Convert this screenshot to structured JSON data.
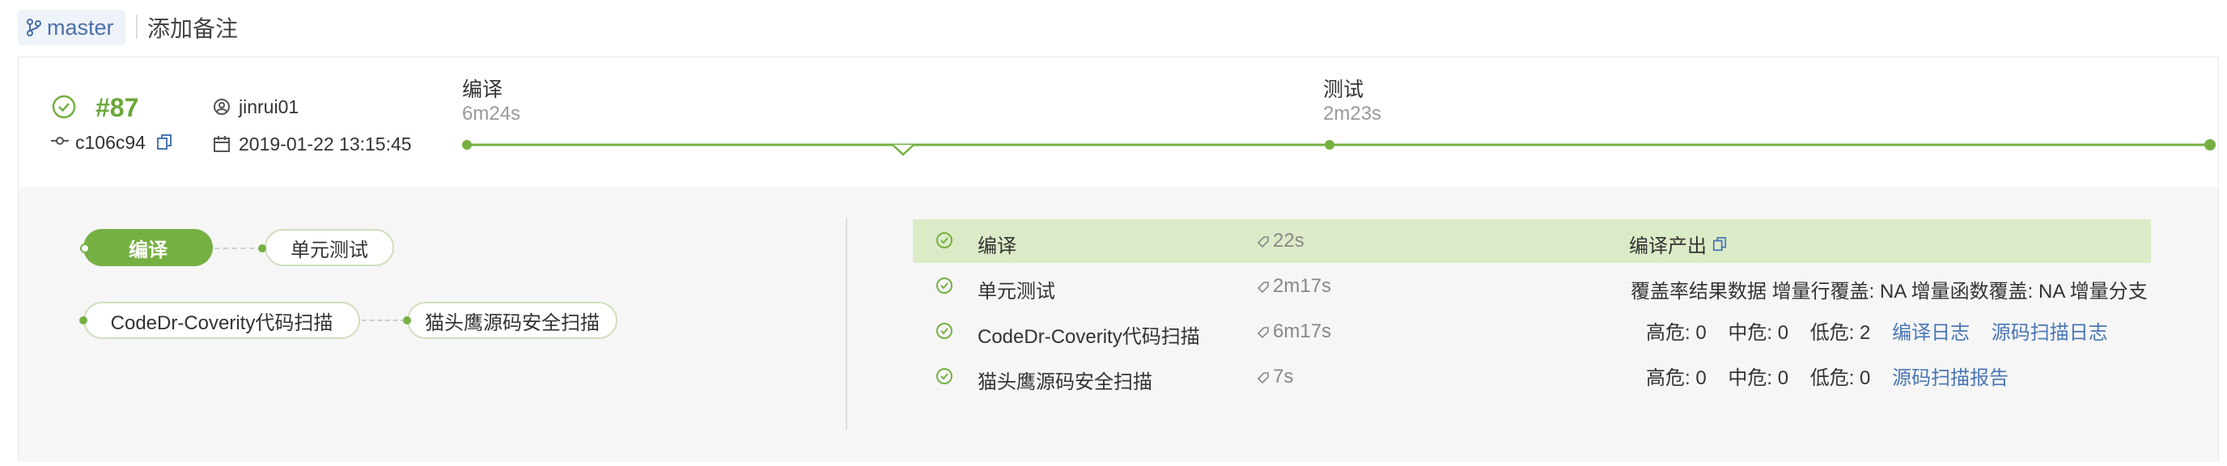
{
  "header": {
    "branch": "master",
    "add_note": "添加备注"
  },
  "build": {
    "number": "#87",
    "commit": "c106c94",
    "user": "jinrui01",
    "datetime": "2019-01-22 13:15:45"
  },
  "timeline": {
    "stages": [
      {
        "name": "编译",
        "duration": "6m24s"
      },
      {
        "name": "测试",
        "duration": "2m23s"
      }
    ]
  },
  "pipeline": {
    "nodes": [
      "编译",
      "单元测试",
      "CodeDr-Coverity代码扫描",
      "猫头鹰源码安全扫描"
    ]
  },
  "jobs": [
    {
      "name": "编译",
      "duration": "22s",
      "artifact_label": "编译产出"
    },
    {
      "name": "单元测试",
      "duration": "2m17s",
      "coverage": "覆盖率结果数据 增量行覆盖: NA 增量函数覆盖: NA 增量分支"
    },
    {
      "name": "CodeDr-Coverity代码扫描",
      "duration": "6m17s",
      "high": "高危: 0",
      "mid": "中危: 0",
      "low": "低危: 2",
      "link1": "编译日志",
      "link2": "源码扫描日志"
    },
    {
      "name": "猫头鹰源码安全扫描",
      "duration": "7s",
      "high": "高危: 0",
      "mid": "中危: 0",
      "low": "低危: 0",
      "link1": "源码扫描报告"
    }
  ],
  "colors": {
    "accent": "#75b043",
    "link": "#4a76b5",
    "highlight_row": "#dcebc7"
  },
  "icons": [
    "branch-icon",
    "check-circle-icon",
    "user-icon",
    "commit-icon",
    "copy-icon",
    "calendar-icon",
    "tag-icon"
  ]
}
